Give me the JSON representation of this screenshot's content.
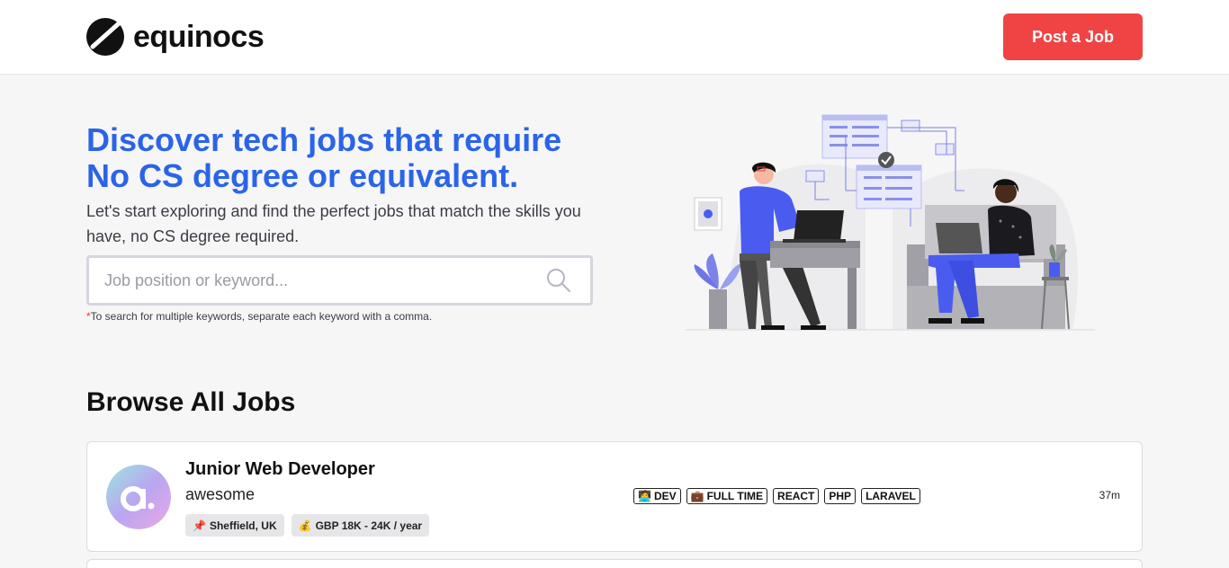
{
  "header": {
    "brand": "equinocs",
    "post_button": "Post a Job"
  },
  "hero": {
    "title_line1": "Discover tech jobs that require",
    "title_line2": "No CS degree or equivalent.",
    "subtitle": "Let's start exploring and find the perfect jobs that match the skills you have, no CS degree required.",
    "search_placeholder": "Job position or keyword...",
    "search_note_star": "*",
    "search_note": "To search for multiple keywords, separate each keyword with a comma."
  },
  "browse": {
    "title": "Browse All Jobs"
  },
  "jobs": [
    {
      "title": "Junior Web Developer",
      "company": "awesome",
      "location_icon": "📌",
      "location": "Sheffield, UK",
      "salary_icon": "💰",
      "salary": "GBP 18K - 24K / year",
      "tags": [
        {
          "icon": "🧑‍💻",
          "label": "DEV"
        },
        {
          "icon": "💼",
          "label": "FULL TIME"
        },
        {
          "icon": "",
          "label": "REACT"
        },
        {
          "icon": "",
          "label": "PHP"
        },
        {
          "icon": "",
          "label": "LARAVEL"
        }
      ],
      "posted": "37m"
    }
  ],
  "colors": {
    "accent_blue": "#2a64e8",
    "button_red": "#f04444",
    "illustration_blue": "#4a5cf0"
  }
}
